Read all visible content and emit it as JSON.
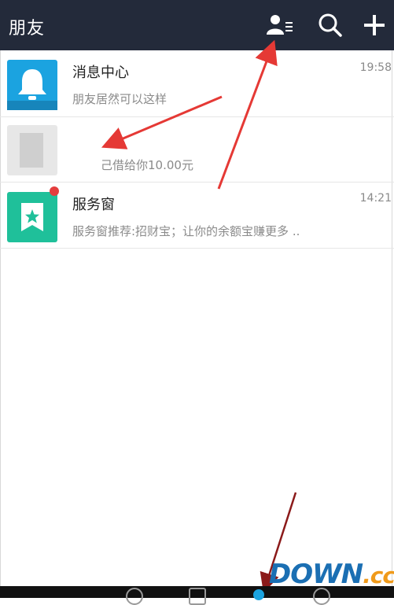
{
  "header": {
    "title": "朋友",
    "icons": [
      "contacts-icon",
      "search-icon",
      "add-icon"
    ]
  },
  "conversations": [
    {
      "name": "消息中心",
      "time": "19:58",
      "preview": "朋友居然可以这样",
      "avatar_icon": "bell-icon",
      "avatar_color": "#1ba3e0"
    },
    {
      "name": "",
      "time": "",
      "preview": "己借给你10.00元",
      "avatar_icon": "blurred-avatar"
    },
    {
      "name": "服务窗",
      "time": "14:21",
      "preview": "服务窗推荐:招财宝；让你的余额宝赚更多 ..",
      "avatar_icon": "star-bookmark-icon",
      "avatar_color": "#1fc09a",
      "unread": true
    }
  ],
  "watermark": {
    "main": "DOWN",
    "suffix": ".cc"
  },
  "colors": {
    "header_bg": "#232a3a",
    "accent_arrow": "#e53935",
    "unread_dot": "#e43d3d"
  }
}
